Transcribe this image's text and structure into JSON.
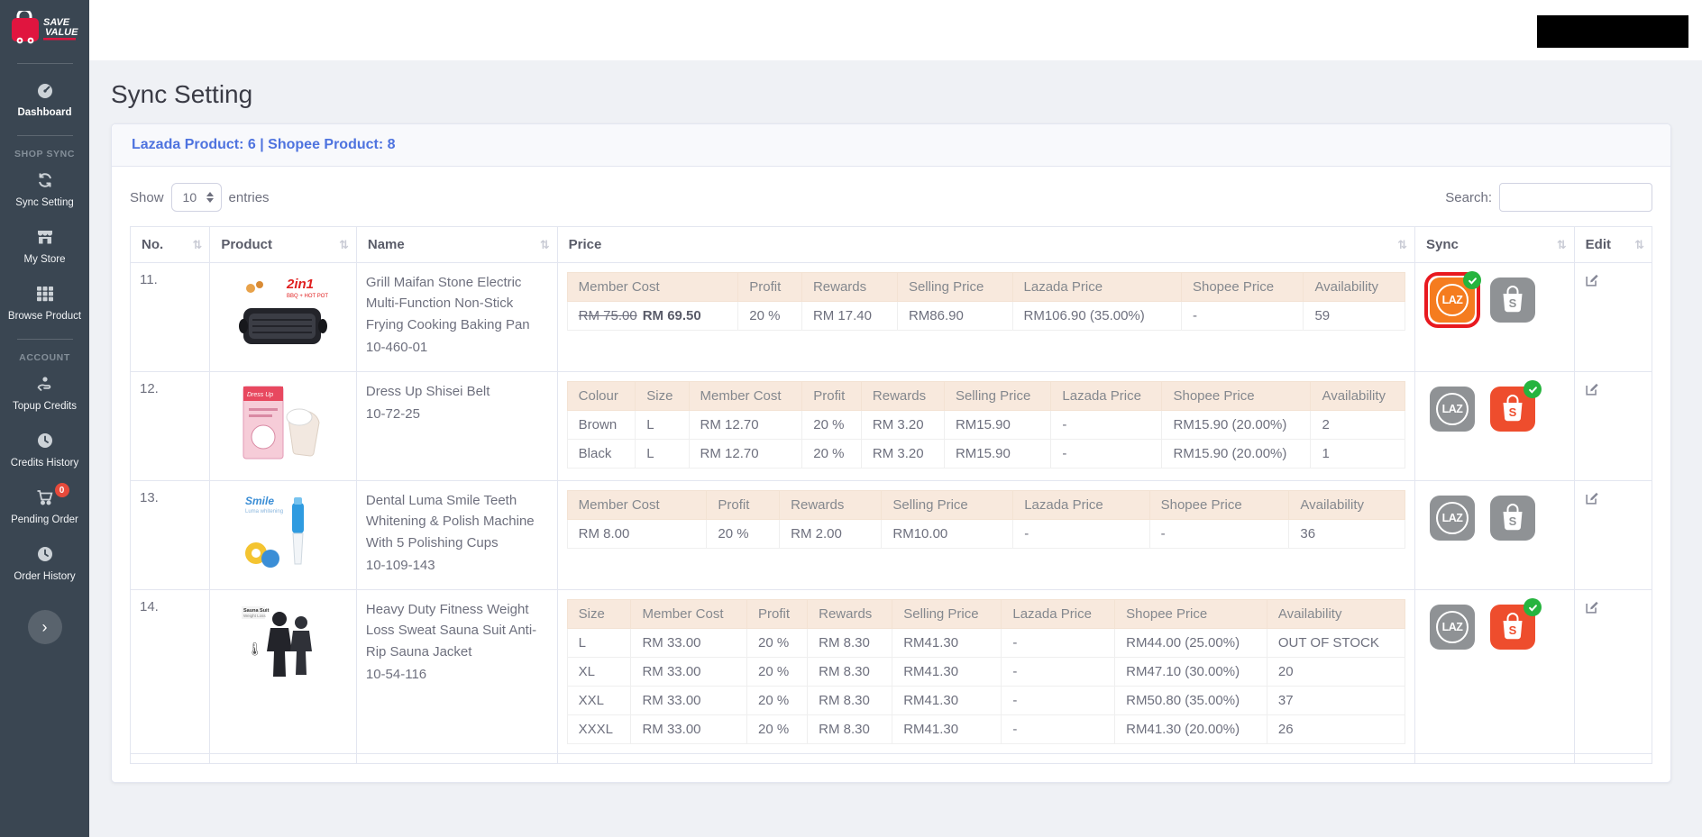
{
  "colors": {
    "accent_blue": "#4e73df",
    "lazada_orange": "#f57c1f",
    "shopee_orange": "#ee4d2d",
    "inactive_gray": "#8f9295",
    "synced_green": "#26b43e",
    "highlight_red": "#e8191f",
    "pending_badge_red": "#e74a3b",
    "sidebar_bg": "#3a4652",
    "nested_header_bg": "#f8e9dd"
  },
  "sidebar": {
    "logo_name": "SAVE VALUE",
    "sections": [
      {
        "heading": null,
        "items": [
          {
            "id": "dashboard",
            "label": "Dashboard",
            "icon": "dashboard-icon",
            "bold": true
          }
        ]
      },
      {
        "heading": "SHOP SYNC",
        "items": [
          {
            "id": "sync-setting",
            "label": "Sync Setting",
            "icon": "sync-icon"
          },
          {
            "id": "my-store",
            "label": "My Store",
            "icon": "store-icon"
          },
          {
            "id": "browse-product",
            "label": "Browse Product",
            "icon": "grid-icon"
          }
        ]
      },
      {
        "heading": "ACCOUNT",
        "items": [
          {
            "id": "topup-credits",
            "label": "Topup Credits",
            "icon": "hand-credits-icon"
          },
          {
            "id": "credits-history",
            "label": "Credits History",
            "icon": "clock-icon"
          },
          {
            "id": "pending-order",
            "label": "Pending Order",
            "icon": "cart-icon",
            "badge": "0"
          },
          {
            "id": "order-history",
            "label": "Order History",
            "icon": "clock-icon"
          }
        ]
      }
    ],
    "collapse_chevron": "›"
  },
  "page": {
    "title": "Sync Setting"
  },
  "card": {
    "header": "Lazada Product: 6 | Shopee Product: 8"
  },
  "controls": {
    "show_label": "Show",
    "entries_label": "entries",
    "page_size": "10",
    "search_label": "Search:",
    "search_value": "",
    "search_placeholder": ""
  },
  "table": {
    "columns": [
      "No.",
      "Product",
      "Name",
      "Price",
      "Sync",
      "Edit"
    ],
    "sort_glyph": "⇅",
    "rows": [
      {
        "no": "11.",
        "image": "grill",
        "name": "Grill Maifan Stone Electric Multi-Function Non-Stick Frying Cooking Baking Pan",
        "sku": "10-460-01",
        "price": {
          "headers": [
            "Member Cost",
            "Profit",
            "Rewards",
            "Selling Price",
            "Lazada Price",
            "Shopee Price",
            "Availability"
          ],
          "rows": [
            [
              {
                "old": "RM 75.00",
                "value": "RM 69.50"
              },
              "20 %",
              "RM 17.40",
              "RM86.90",
              "RM106.90 (35.00%)",
              "-",
              "59"
            ]
          ]
        },
        "sync": {
          "lazada": {
            "active": true,
            "badge": true,
            "highlight": true
          },
          "shopee": {
            "active": false,
            "badge": false,
            "highlight": false
          }
        }
      },
      {
        "no": "12.",
        "image": "belt",
        "name": "Dress Up Shisei Belt",
        "sku": "10-72-25",
        "price": {
          "headers": [
            "Colour",
            "Size",
            "Member Cost",
            "Profit",
            "Rewards",
            "Selling Price",
            "Lazada Price",
            "Shopee Price",
            "Availability"
          ],
          "rows": [
            [
              "Brown",
              "L",
              "RM 12.70",
              "20 %",
              "RM 3.20",
              "RM15.90",
              "-",
              "RM15.90 (20.00%)",
              "2"
            ],
            [
              "Black",
              "L",
              "RM 12.70",
              "20 %",
              "RM 3.20",
              "RM15.90",
              "-",
              "RM15.90 (20.00%)",
              "1"
            ]
          ]
        },
        "sync": {
          "lazada": {
            "active": false,
            "badge": false,
            "highlight": false
          },
          "shopee": {
            "active": true,
            "badge": true,
            "highlight": false
          }
        }
      },
      {
        "no": "13.",
        "image": "dental",
        "name": "Dental Luma Smile Teeth Whitening & Polish Machine With 5 Polishing Cups",
        "sku": "10-109-143",
        "price": {
          "headers": [
            "Member Cost",
            "Profit",
            "Rewards",
            "Selling Price",
            "Lazada Price",
            "Shopee Price",
            "Availability"
          ],
          "rows": [
            [
              "RM 8.00",
              "20 %",
              "RM 2.00",
              "RM10.00",
              "-",
              "-",
              "36"
            ]
          ]
        },
        "sync": {
          "lazada": {
            "active": false,
            "badge": false,
            "highlight": false
          },
          "shopee": {
            "active": false,
            "badge": false,
            "highlight": false
          }
        }
      },
      {
        "no": "14.",
        "image": "sauna",
        "name": "Heavy Duty Fitness Weight Loss Sweat Sauna Suit Anti-Rip Sauna Jacket",
        "sku": "10-54-116",
        "price": {
          "headers": [
            "Size",
            "Member Cost",
            "Profit",
            "Rewards",
            "Selling Price",
            "Lazada Price",
            "Shopee Price",
            "Availability"
          ],
          "rows": [
            [
              "L",
              "RM 33.00",
              "20 %",
              "RM 8.30",
              "RM41.30",
              "-",
              "RM44.00 (25.00%)",
              "OUT OF STOCK"
            ],
            [
              "XL",
              "RM 33.00",
              "20 %",
              "RM 8.30",
              "RM41.30",
              "-",
              "RM47.10 (30.00%)",
              "20"
            ],
            [
              "XXL",
              "RM 33.00",
              "20 %",
              "RM 8.30",
              "RM41.30",
              "-",
              "RM50.80 (35.00%)",
              "37"
            ],
            [
              "XXXL",
              "RM 33.00",
              "20 %",
              "RM 8.30",
              "RM41.30",
              "-",
              "RM41.30 (20.00%)",
              "26"
            ]
          ]
        },
        "sync": {
          "lazada": {
            "active": false,
            "badge": false,
            "highlight": false
          },
          "shopee": {
            "active": true,
            "badge": true,
            "highlight": false
          }
        }
      }
    ]
  }
}
